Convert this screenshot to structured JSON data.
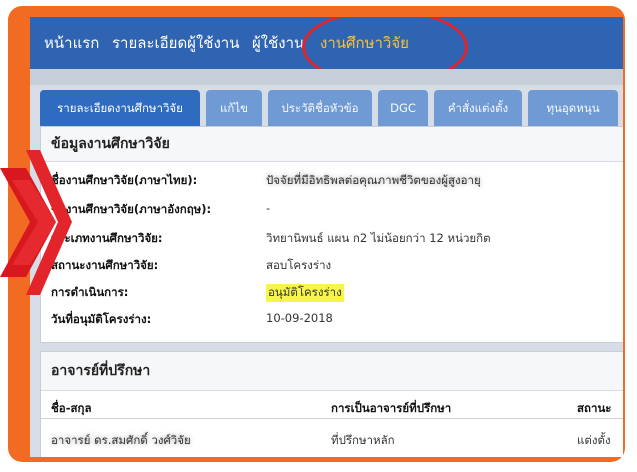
{
  "nav": {
    "items": [
      {
        "label": "หน้าแรก"
      },
      {
        "label": "รายละเอียดผู้ใช้งาน"
      },
      {
        "label": "ผู้ใช้งาน"
      },
      {
        "label": "งานศึกษาวิจัย"
      }
    ],
    "active_index": 3
  },
  "tabs": [
    {
      "label": "รายละเอียดงานศึกษาวิจัย"
    },
    {
      "label": "แก้ไข"
    },
    {
      "label": "ประวัติชื่อหัวข้อ"
    },
    {
      "label": "DGC"
    },
    {
      "label": "คำสั่งแต่งตั้ง"
    },
    {
      "label": "ทุนอุดหนุน"
    }
  ],
  "research": {
    "title": "ข้อมูลงานศึกษาวิจัย",
    "fields": [
      {
        "label": "ชื่องานศึกษาวิจัย(ภาษาไทย):",
        "value": "ปัจจัยที่มีอิทธิพลต่อคุณภาพชีวิตของผู้สูงอายุ"
      },
      {
        "label": "ชื่องานศึกษาวิจัย(ภาษาอังกฤษ):",
        "value": "-"
      },
      {
        "label": "ประเภทงานศึกษาวิจัย:",
        "value": "วิทยานิพนธ์ แผน ก2 ไม่น้อยกว่า 12 หน่วยกิต"
      },
      {
        "label": "สถานะงานศึกษาวิจัย:",
        "value": "สอบโครงร่าง"
      },
      {
        "label": "การดำเนินการ:",
        "value": "อนุมัติโครงร่าง"
      },
      {
        "label": "วันที่อนุมัติโครงร่าง:",
        "value": "10-09-2018"
      }
    ]
  },
  "advisors": {
    "title": "อาจารย์ที่ปรึกษา",
    "columns": [
      "ชื่อ-สกุล",
      "การเป็นอาจารย์ที่ปรึกษา",
      "สถานะ"
    ],
    "rows": [
      {
        "name": "อาจารย์ ดร.สมศักดิ์ วงศ์วิจัย",
        "role": "ที่ปรึกษาหลัก",
        "status": "แต่งตั้ง"
      }
    ]
  },
  "colors": {
    "frame": "#f16b22",
    "nav_bg": "#2f64b3",
    "nav_active": "#f7c23a",
    "highlight_circle": "#e3242b",
    "tab_active": "#2f6cc0",
    "mark": "#f7f54a"
  },
  "icons": {
    "pointer": "red-chevron-arrow-icon"
  }
}
